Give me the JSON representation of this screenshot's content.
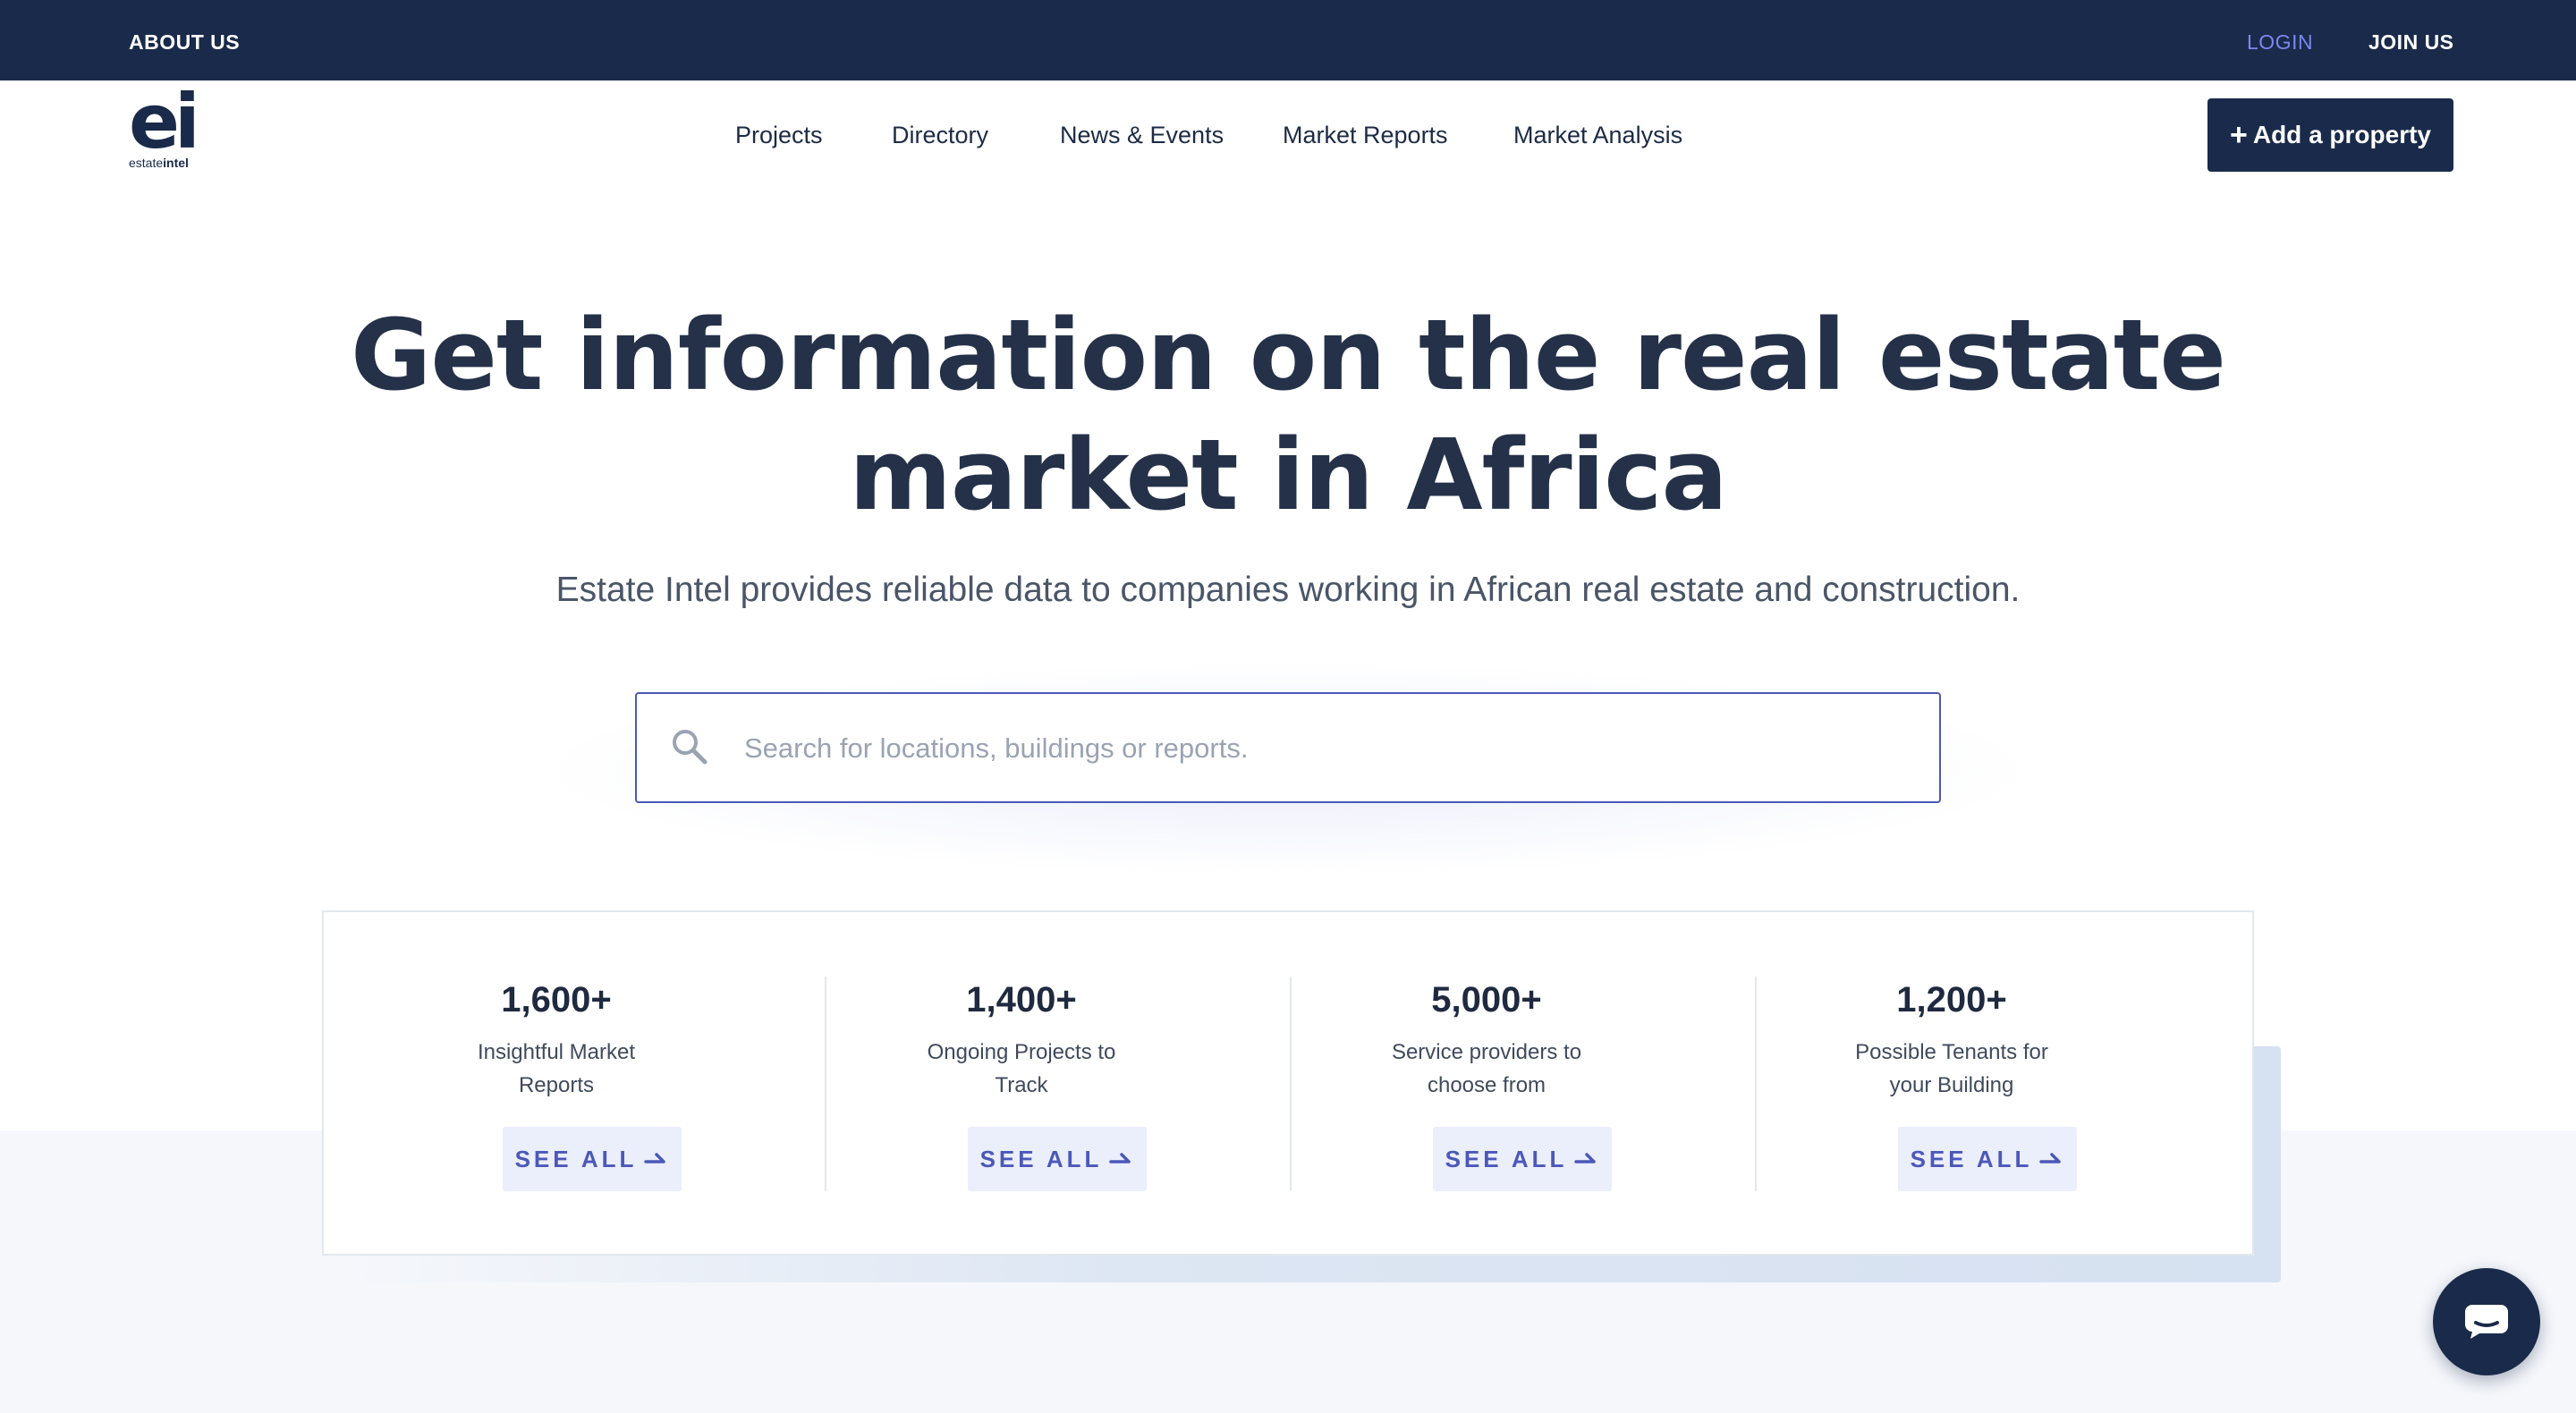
{
  "topbar": {
    "about": "ABOUT US",
    "login": "LOGIN",
    "join": "JOIN US"
  },
  "logo": {
    "mark": "ei",
    "wordmark_light": "estate",
    "wordmark_bold": "intel"
  },
  "nav": {
    "items": [
      "Projects",
      "Directory",
      "News & Events",
      "Market Reports",
      "Market Analysis"
    ]
  },
  "header": {
    "add_button": "Add a property",
    "add_icon": "plus-icon"
  },
  "hero": {
    "title_line1": "Get information on the real estate",
    "title_line2": "market in Africa",
    "subtitle": "Estate Intel provides reliable data to companies working in African real estate and construction."
  },
  "search": {
    "placeholder": "Search for locations, buildings or reports.",
    "value": "",
    "icon": "search-icon"
  },
  "stats": [
    {
      "number": "1,600+",
      "desc_line1": "Insightful Market",
      "desc_line2": "Reports",
      "button": "SEE ALL"
    },
    {
      "number": "1,400+",
      "desc_line1": "Ongoing Projects to",
      "desc_line2": "Track",
      "button": "SEE ALL"
    },
    {
      "number": "5,000+",
      "desc_line1": "Service providers to",
      "desc_line2": "choose from",
      "button": "SEE ALL"
    },
    {
      "number": "1,200+",
      "desc_line1": "Possible Tenants for",
      "desc_line2": "your Building",
      "button": "SEE ALL"
    }
  ],
  "colors": {
    "navy": "#1a2a4a",
    "accent": "#4b58b8",
    "login": "#7b86f0"
  },
  "chat": {
    "icon": "chat-bubble-icon"
  }
}
